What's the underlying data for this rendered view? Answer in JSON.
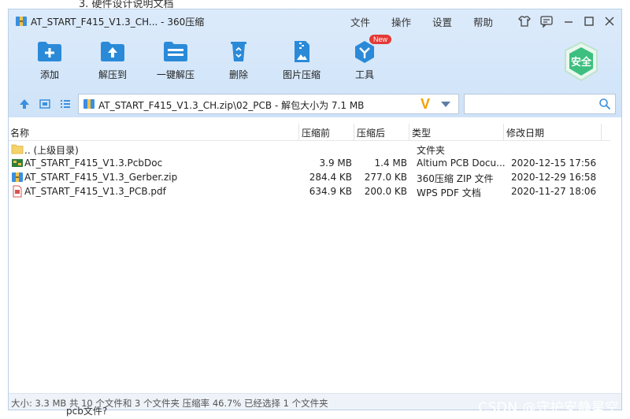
{
  "background": {
    "doc_top_text": "3. 硬件设计说明文档",
    "doc_bottom_text": "pcb文件?",
    "watermark": "CSDN @守护安静星空"
  },
  "window": {
    "title": "AT_START_F415_V1.3_CH... - 360压缩",
    "menus": [
      "文件",
      "操作",
      "设置",
      "帮助"
    ]
  },
  "toolbar": {
    "add": "添加",
    "extract_to": "解压到",
    "one_click_extract": "一键解压",
    "delete": "删除",
    "image_compress": "图片压缩",
    "tools": "工具",
    "new_badge": "New",
    "safe": "安全"
  },
  "address": {
    "path": "AT_START_F415_V1.3_CH.zip\\02_PCB - 解包大小为 7.1 MB",
    "search_placeholder": ""
  },
  "columns": {
    "name": "名称",
    "compressed_before": "压缩前",
    "compressed_after": "压缩后",
    "type": "类型",
    "modified": "修改日期"
  },
  "files": [
    {
      "name": ".. (上级目录)",
      "before": "",
      "after": "",
      "type": "文件夹",
      "date": "",
      "icon": "folder-icon"
    },
    {
      "name": "AT_START_F415_V1.3.PcbDoc",
      "before": "3.9 MB",
      "after": "1.4 MB",
      "type": "Altium PCB Docu...",
      "date": "2020-12-15 17:56",
      "icon": "pcb-file-icon"
    },
    {
      "name": "AT_START_F415_V1.3_Gerber.zip",
      "before": "284.4 KB",
      "after": "277.0 KB",
      "type": "360压缩 ZIP 文件",
      "date": "2020-12-29 16:58",
      "icon": "zip-file-icon"
    },
    {
      "name": "AT_START_F415_V1.3_PCB.pdf",
      "before": "634.9 KB",
      "after": "200.0 KB",
      "type": "WPS PDF 文档",
      "date": "2020-11-27 18:06",
      "icon": "pdf-file-icon"
    }
  ],
  "status": {
    "text": "大小: 3.3 MB 共 10 个文件和 3 个文件夹 压缩率 46.7% 已经选择 1 个文件夹"
  },
  "colors": {
    "accent": "#2a8ad8",
    "toolbar_bg": "#d6e7fa",
    "badge_red": "#e53935",
    "safe_green": "#36b37e"
  }
}
